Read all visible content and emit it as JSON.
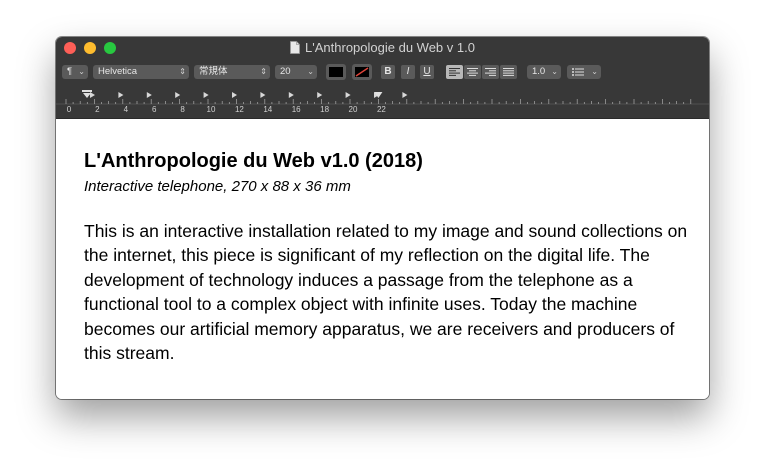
{
  "window": {
    "title": "L'Anthropologie du Web v 1.0"
  },
  "toolbar": {
    "paragraph_style": "¶",
    "font_family": "Helvetica",
    "font_style": "常規体",
    "font_size": "20",
    "bold_label": "B",
    "italic_label": "I",
    "underline_label": "U",
    "line_spacing": "1.0",
    "text_color": "#000000",
    "highlight_color": "none"
  },
  "ruler": {
    "labels": [
      "0",
      "2",
      "4",
      "6",
      "8",
      "10",
      "12",
      "14",
      "16",
      "18",
      "20",
      "22"
    ]
  },
  "document": {
    "title": "L'Anthropologie du Web v1.0 (2018)",
    "subtitle": "Interactive telephone, 270 x 88 x 36 mm",
    "body": "This is an interactive installation related to my image and sound collections on the internet, this piece is significant of my reflection on the digital life. The development of technology induces a passage from the telephone as a functional tool to a complex object with infinite uses. Today the machine becomes our artificial memory apparatus, we are receivers and producers of this stream."
  },
  "colors": {
    "close": "#fe5f57",
    "minimize": "#febc2e",
    "zoom": "#28c840",
    "chrome": "#383838"
  }
}
